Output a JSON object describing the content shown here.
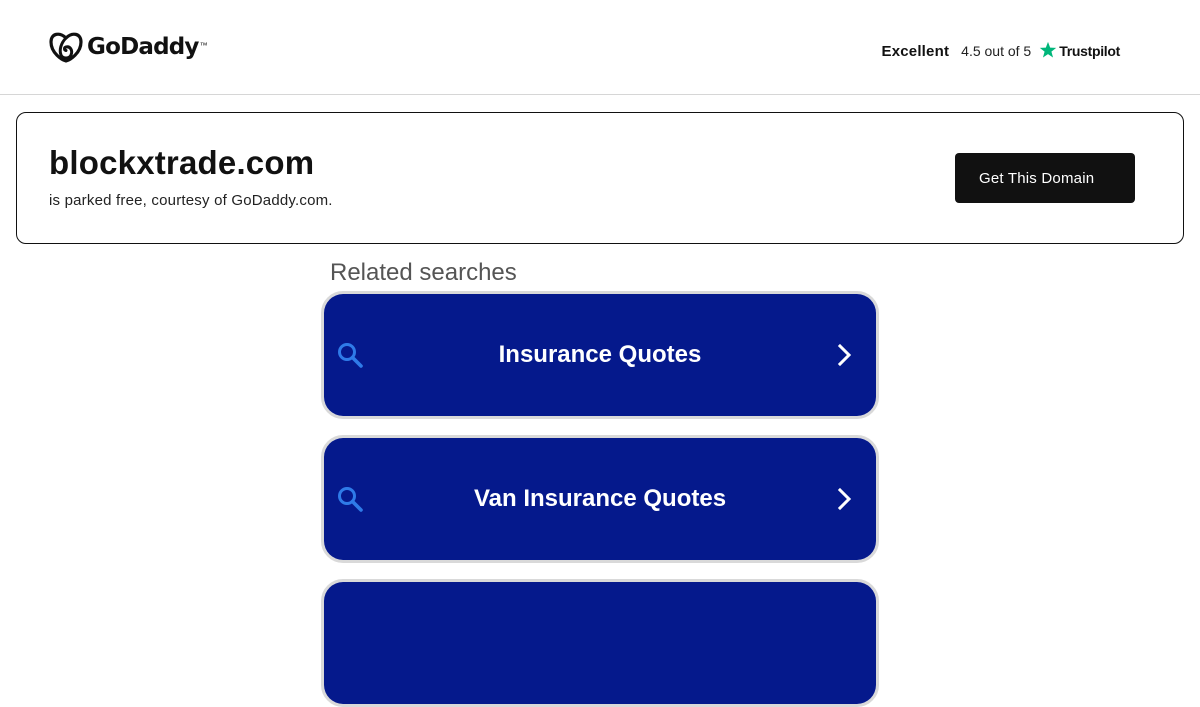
{
  "header": {
    "logo_text": "GoDaddy",
    "logo_tm": "™",
    "trustpilot": {
      "excellent": "Excellent",
      "rating_text": "4.5 out of 5",
      "brand": "Trustpilot",
      "star_color": "#00b67a"
    }
  },
  "banner": {
    "domain": "blockxtrade.com",
    "subtitle": "is parked free, courtesy of GoDaddy.com.",
    "cta_label": "Get This Domain"
  },
  "related": {
    "title": "Related searches",
    "items": [
      {
        "label": "Insurance Quotes"
      },
      {
        "label": "Van Insurance Quotes"
      },
      {
        "label": ""
      }
    ],
    "button_color": "#05198c",
    "search_icon_color": "#2f7be8"
  }
}
